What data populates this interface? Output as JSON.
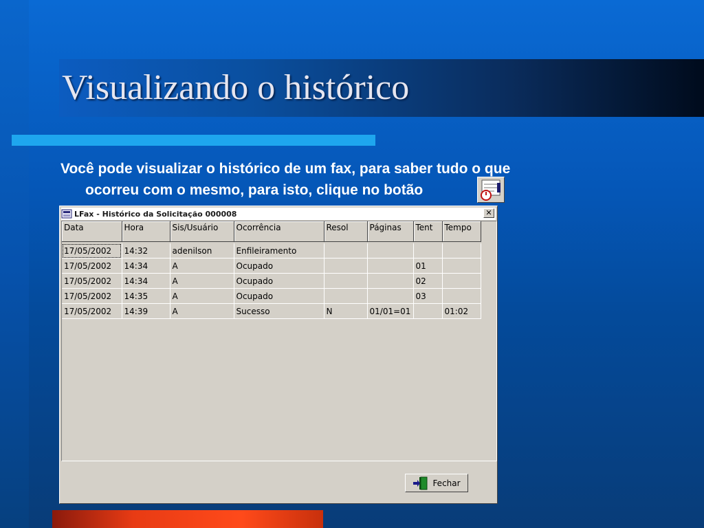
{
  "slide": {
    "title": "Visualizando o histórico",
    "body_line1": "Você pode visualizar o histórico de um fax, para saber tudo o que",
    "body_line2": "ocorreu com o mesmo, para isto, clique no botão"
  },
  "window": {
    "title": "LFax - Histórico da Solicitação 000008",
    "close_glyph": "✕",
    "columns": [
      "Data",
      "Hora",
      "Sis/Usuário",
      "Ocorrência",
      "Resol",
      "Páginas",
      "Tent",
      "Tempo"
    ],
    "rows": [
      [
        "17/05/2002",
        "14:32",
        "adenilson",
        "Enfileiramento",
        "",
        "",
        "",
        ""
      ],
      [
        "17/05/2002",
        "14:34",
        "A",
        "Ocupado",
        "",
        "",
        "01",
        ""
      ],
      [
        "17/05/2002",
        "14:34",
        "A",
        "Ocupado",
        "",
        "",
        "02",
        ""
      ],
      [
        "17/05/2002",
        "14:35",
        "A",
        "Ocupado",
        "",
        "",
        "03",
        ""
      ],
      [
        "17/05/2002",
        "14:39",
        "A",
        "Sucesso",
        "N",
        "01/01=01",
        "",
        "01:02"
      ]
    ],
    "close_button_label": "Fechar"
  },
  "colors": {
    "background": "#0557b8",
    "accent_line": "#1ea6ee",
    "bottom_accent": "#e83b14",
    "window_face": "#d4d0c8"
  },
  "icons": {
    "window_app_icon": "fax-icon",
    "history_button": "history-icon",
    "close_button": "exit-door-icon"
  }
}
